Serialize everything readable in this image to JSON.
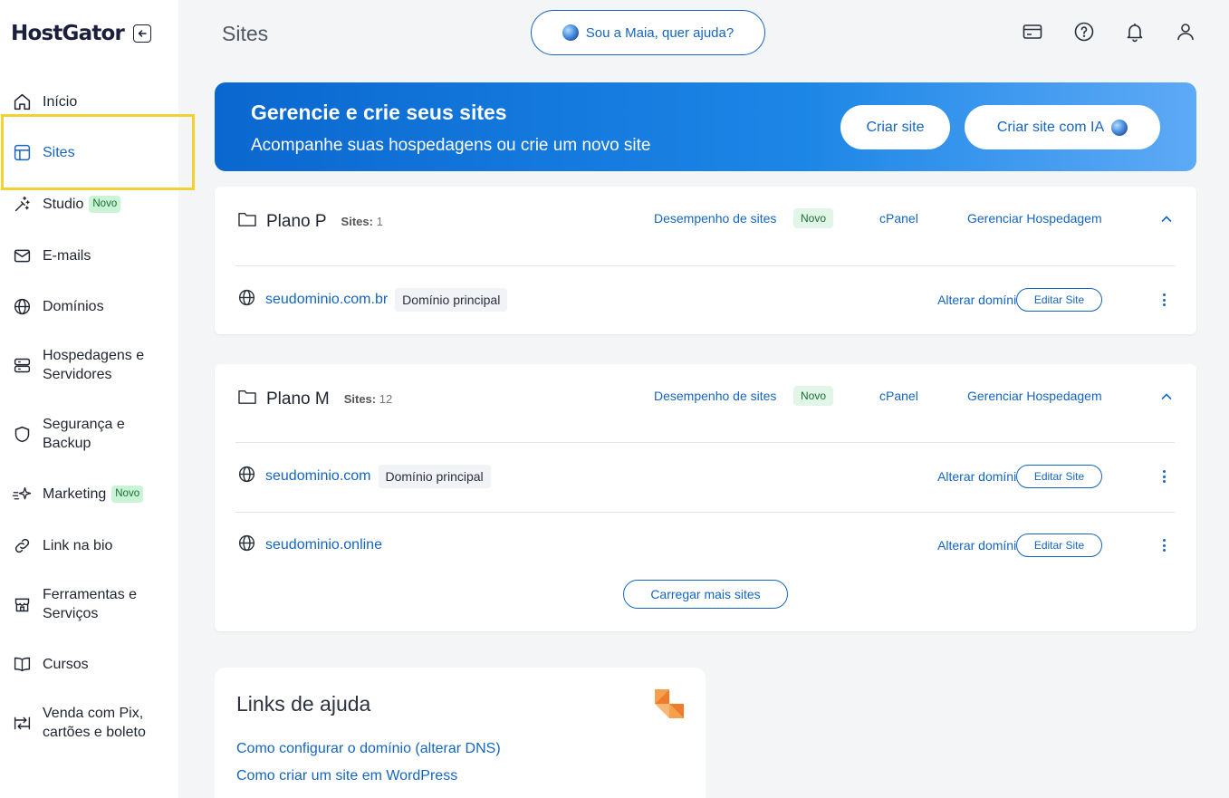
{
  "brand": {
    "name": "HostGator"
  },
  "sidebar": {
    "items": [
      {
        "label": "Início",
        "icon": "home-icon",
        "active": false
      },
      {
        "label": "Sites",
        "icon": "layout-icon",
        "active": true
      },
      {
        "label": "Studio",
        "icon": "magic-icon",
        "badge": "Novo"
      },
      {
        "label": "E-mails",
        "icon": "mail-icon"
      },
      {
        "label": "Domínios",
        "icon": "globe-icon"
      },
      {
        "label": "Hospedagens e Servidores",
        "icon": "server-icon"
      },
      {
        "label": "Segurança e Backup",
        "icon": "shield-icon"
      },
      {
        "label": "Marketing",
        "icon": "sparkle-icon",
        "badge": "Novo"
      },
      {
        "label": "Link na bio",
        "icon": "link-icon"
      },
      {
        "label": "Ferramentas e Serviços",
        "icon": "tools-icon"
      },
      {
        "label": "Cursos",
        "icon": "book-icon"
      },
      {
        "label": "Venda com Pix, cartões e boleto",
        "icon": "payment-icon"
      }
    ]
  },
  "header": {
    "title": "Sites",
    "assistant_label": "Sou a Maia, quer ajuda?"
  },
  "banner": {
    "title": "Gerencie e crie seus sites",
    "subtitle": "Acompanhe suas hospedagens ou crie um novo site",
    "create_label": "Criar site",
    "create_ai_label": "Criar site com IA"
  },
  "plans": [
    {
      "name": "Plano P",
      "sites_label": "Sites:",
      "sites_count": "1",
      "performance_label": "Desempenho de sites",
      "performance_badge": "Novo",
      "cpanel_label": "cPanel",
      "manage_label": "Gerenciar Hospedagem",
      "sites": [
        {
          "domain": "seudominio.com.br",
          "tag": "Domínio principal",
          "change_label": "Alterar domínio",
          "edit_label": "Editar Site"
        }
      ]
    },
    {
      "name": "Plano M",
      "sites_label": "Sites:",
      "sites_count": "12",
      "performance_label": "Desempenho de sites",
      "performance_badge": "Novo",
      "cpanel_label": "cPanel",
      "manage_label": "Gerenciar Hospedagem",
      "sites": [
        {
          "domain": "seudominio.com",
          "tag": "Domínio principal",
          "change_label": "Alterar domínio",
          "edit_label": "Editar Site"
        },
        {
          "domain": "seudominio.online",
          "tag": "",
          "change_label": "Alterar domínio",
          "edit_label": "Editar Site"
        }
      ],
      "load_more_label": "Carregar mais sites"
    }
  ],
  "help": {
    "title": "Links de ajuda",
    "links": [
      "Como configurar o domínio (alterar DNS)",
      "Como criar um site em WordPress"
    ]
  },
  "colors": {
    "accent": "#1565c0",
    "banner_start": "#0a67cf",
    "banner_end": "#5eaaf6",
    "highlight": "#f2d230",
    "badge_green": "#c9f4d6"
  }
}
